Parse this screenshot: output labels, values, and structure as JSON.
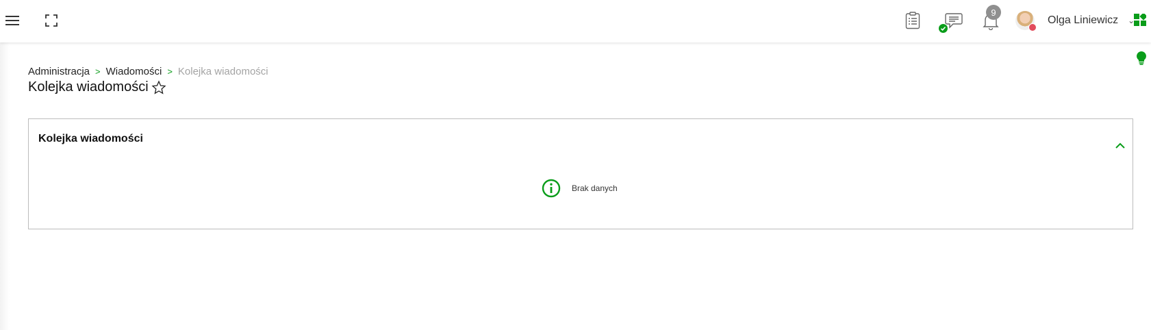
{
  "header": {
    "user_name": "Olga Liniewicz",
    "notification_count": "9",
    "icons": {
      "menu": "menu-icon",
      "fullscreen": "fullscreen-icon",
      "tasks": "clipboard-icon",
      "chat": "chat-icon",
      "notifications": "bell-icon",
      "apps": "apps-grid-icon",
      "tip": "lightbulb-icon"
    }
  },
  "breadcrumb": {
    "items": [
      "Administracja",
      "Wiadomości",
      "Kolejka wiadomości"
    ],
    "separator": ">"
  },
  "page": {
    "title": "Kolejka wiadomości"
  },
  "panel": {
    "title": "Kolejka wiadomości",
    "empty_text": "Brak danych"
  },
  "colors": {
    "accent": "#0a9d1a",
    "user_status": "#e24c5c",
    "badge": "#8f8f8f",
    "muted_text": "#a4a4a4"
  }
}
